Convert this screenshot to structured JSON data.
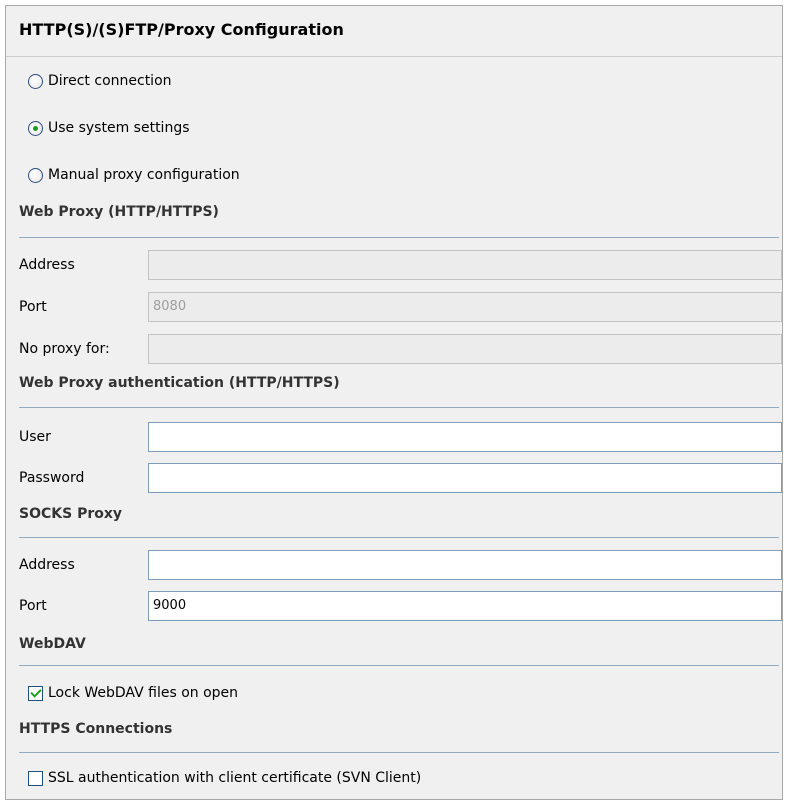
{
  "title": "HTTP(S)/(S)FTP/Proxy Configuration",
  "connection": {
    "options": [
      {
        "label": "Direct connection",
        "selected": false
      },
      {
        "label": "Use system settings",
        "selected": true
      },
      {
        "label": "Manual proxy configuration",
        "selected": false
      }
    ]
  },
  "web_proxy": {
    "heading": "Web Proxy (HTTP/HTTPS)",
    "address_label": "Address",
    "address_value": "",
    "port_label": "Port",
    "port_value": "8080",
    "no_proxy_label": "No proxy for:",
    "no_proxy_value": ""
  },
  "web_proxy_auth": {
    "heading": "Web Proxy authentication (HTTP/HTTPS)",
    "user_label": "User",
    "user_value": "",
    "password_label": "Password",
    "password_value": ""
  },
  "socks_proxy": {
    "heading": "SOCKS Proxy",
    "address_label": "Address",
    "address_value": "",
    "port_label": "Port",
    "port_value": "9000"
  },
  "webdav": {
    "heading": "WebDAV",
    "lock_label": "Lock WebDAV files on open",
    "lock_checked": true
  },
  "https": {
    "heading": "HTTPS Connections",
    "ssl_label": "SSL authentication with client certificate (SVN Client)",
    "ssl_checked": false
  }
}
